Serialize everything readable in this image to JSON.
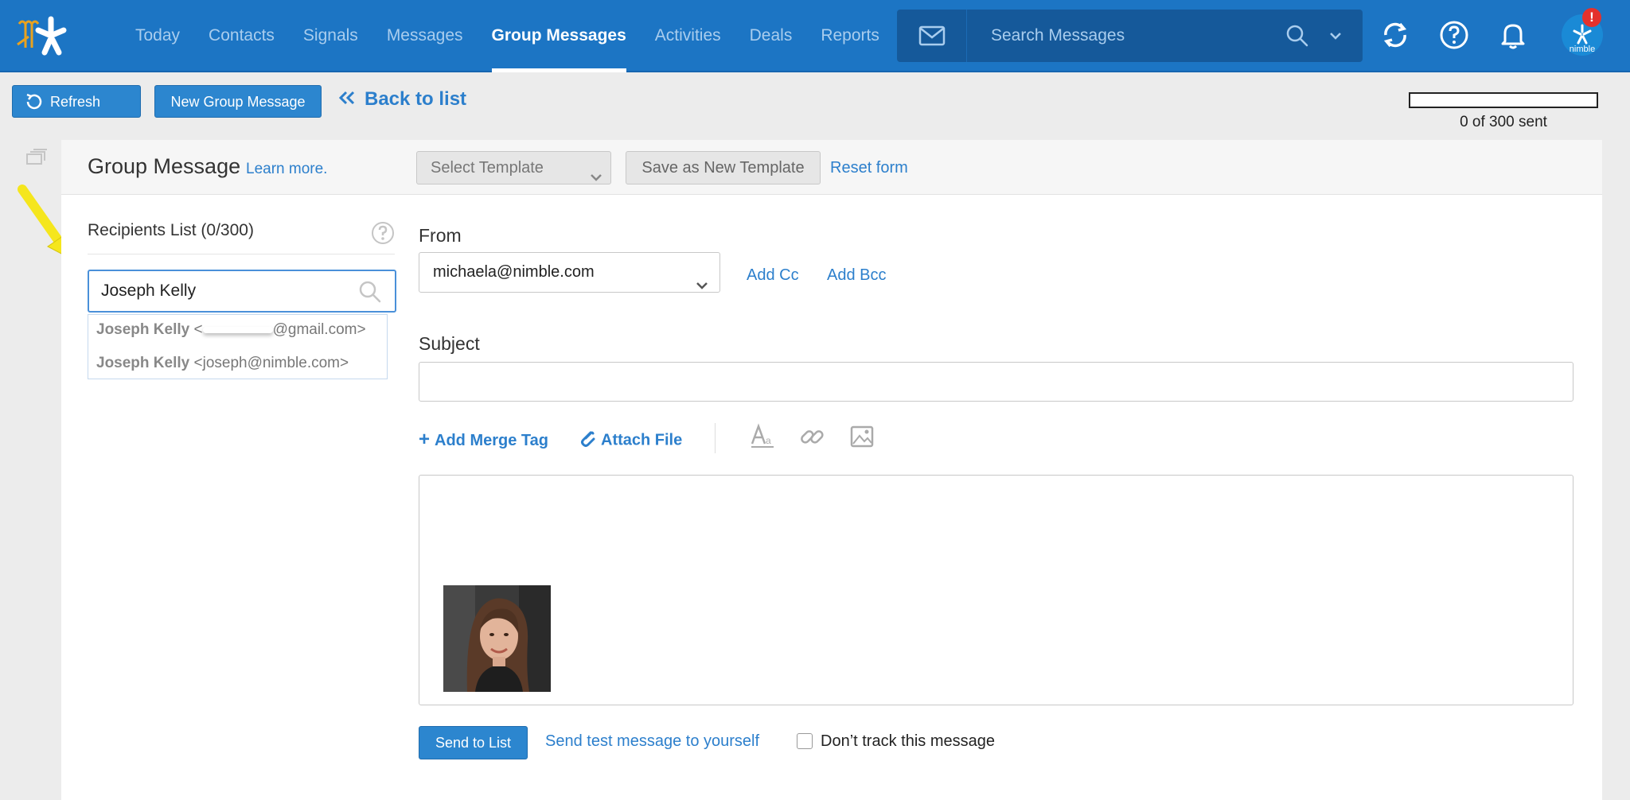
{
  "nav": {
    "items": [
      {
        "label": "Today"
      },
      {
        "label": "Contacts"
      },
      {
        "label": "Signals"
      },
      {
        "label": "Messages"
      },
      {
        "label": "Group Messages",
        "active": true
      },
      {
        "label": "Activities"
      },
      {
        "label": "Deals"
      },
      {
        "label": "Reports"
      }
    ],
    "search_placeholder": "Search Messages",
    "avatar_label": "nimble",
    "alert_badge": "!",
    "icons": [
      "logo-icon",
      "mail-icon",
      "search-icon",
      "chevron-down-icon",
      "sync-icon",
      "help-icon",
      "bell-icon",
      "avatar"
    ]
  },
  "toolbar": {
    "refresh_label": "Refresh",
    "new_group_message_label": "New Group Message",
    "back_label": "Back to list",
    "progress_value": 0,
    "progress_text": "0 of 300 sent"
  },
  "panel": {
    "title": "Group Message",
    "learn_more": "Learn more.",
    "select_template": "Select Template",
    "save_template": "Save as New Template",
    "reset_form": "Reset form"
  },
  "recipients": {
    "title": "Recipients List (0/300)",
    "search_value": "Joseph Kelly",
    "suggestions": [
      {
        "name": "Joseph Kelly",
        "email_prefix": " <",
        "email_suffix": "@gmail.com>"
      },
      {
        "name": "Joseph Kelly",
        "email_prefix": " <joseph@nimble.com>",
        "email_suffix": ""
      }
    ]
  },
  "form": {
    "from_label": "From",
    "from_value": "michaela@nimble.com",
    "add_cc": "Add Cc",
    "add_bcc": "Add Bcc",
    "subject_label": "Subject",
    "subject_value": "",
    "add_merge_tag": "Add Merge Tag",
    "attach_file": "Attach File",
    "send_label": "Send to List",
    "send_test_label": "Send test message to yourself",
    "dont_track_label": "Don’t track this message",
    "dont_track_checked": false
  },
  "colors": {
    "topbar": "#1c75c4",
    "accent": "#2c86cf",
    "link": "#2c7fcc",
    "alert": "#e4312c",
    "arrow": "#f5e61d"
  }
}
